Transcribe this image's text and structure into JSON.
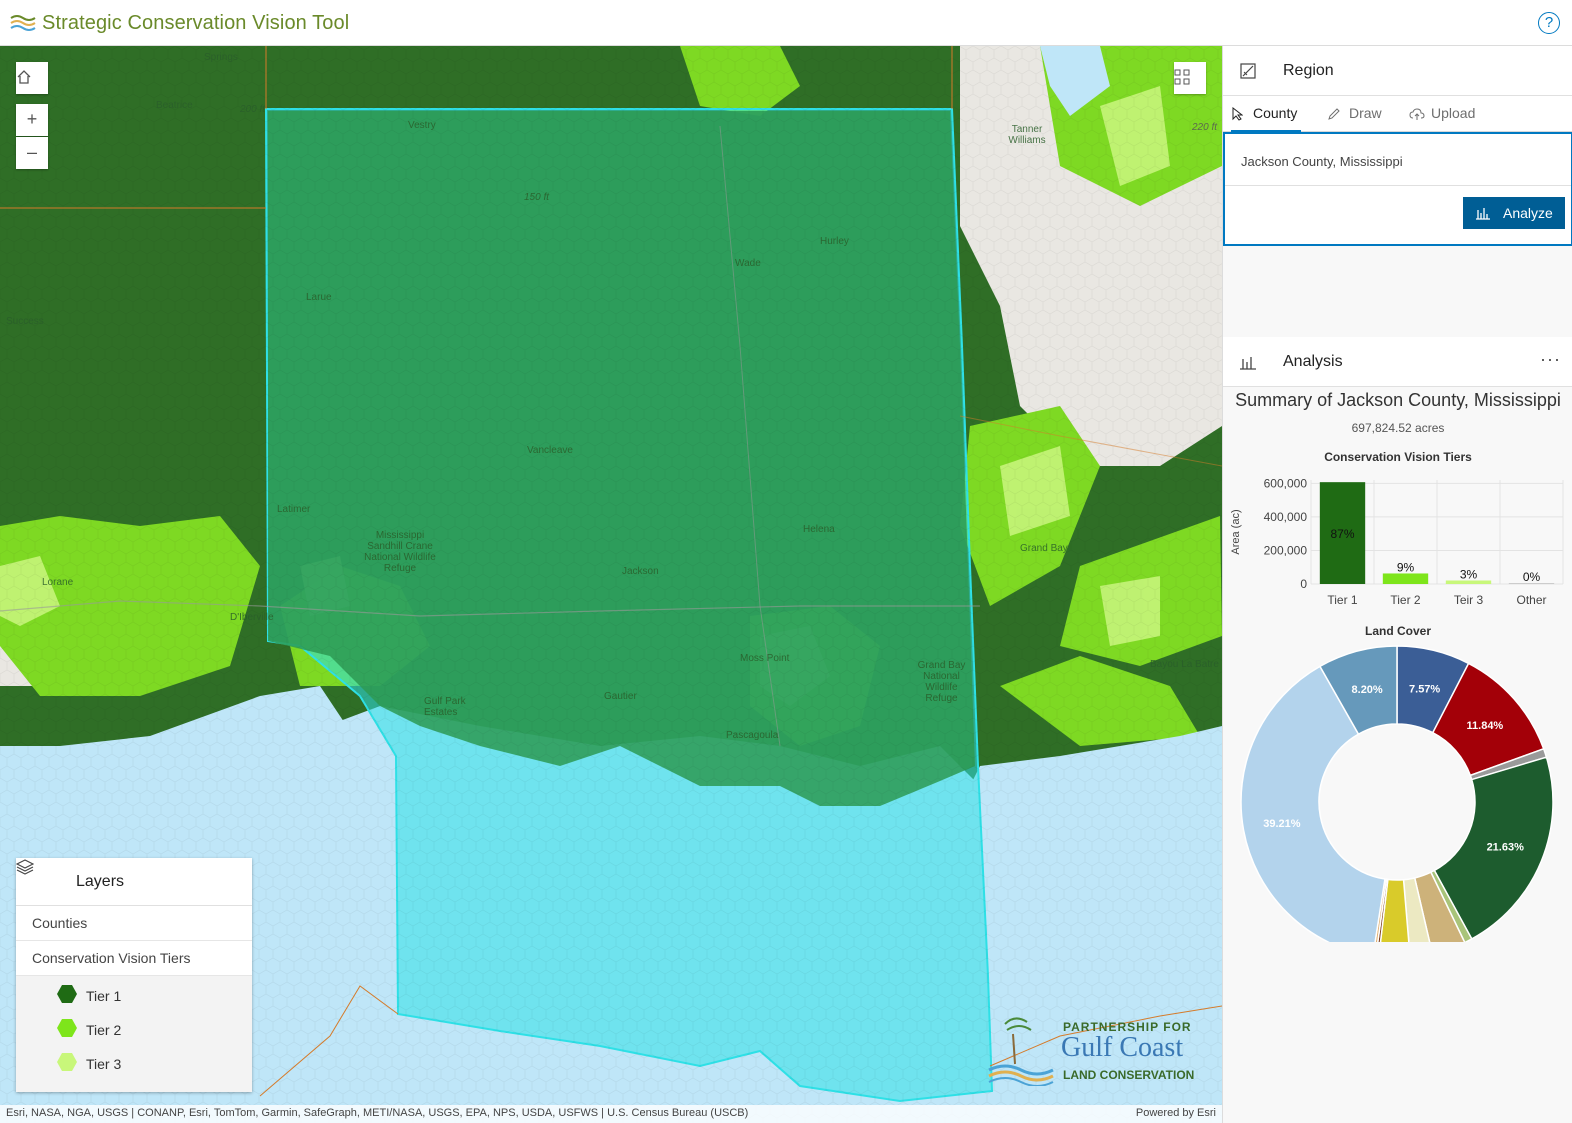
{
  "header": {
    "title": "Strategic Conservation Vision Tool",
    "help_label": "?"
  },
  "map": {
    "zoom_in": "+",
    "zoom_out": "–",
    "labels": [
      "Springs",
      "Beatrice",
      "Vestry",
      "Wade",
      "Larue",
      "Hurley",
      "Vancleave",
      "Latimer",
      "Mississippi Sandhill Crane National Wildlife Refuge",
      "Jackson",
      "Helena",
      "Moss Point",
      "Gautier",
      "Gulf Park Estates",
      "Pascagoula",
      "Grand Bay National Wildlife Refuge",
      "Grand Bay",
      "Bayou La Batre",
      "Tanner Williams",
      "Lorane",
      "D'Iberville",
      "Success",
      "220 ft",
      "150 ft",
      "200 ft"
    ],
    "attribution": "Esri, NASA, NGA, USGS | CONANP, Esri, TomTom, Garmin, SafeGraph, METI/NASA, USGS, EPA, NPS, USDA, USFWS | U.S. Census Bureau (USCB)",
    "powered_by": "Powered by Esri",
    "logo": {
      "line1": "PARTNERSHIP FOR",
      "line2": "Gulf Coast",
      "line3": "LAND CONSERVATION"
    },
    "colors": {
      "tier1": "#2e6f27",
      "tier2": "#84e01d",
      "tier3": "#c3f46a",
      "selection": "#2ee0e6",
      "water": "#bfe6f8"
    }
  },
  "layers": {
    "title": "Layers",
    "items": [
      "Counties",
      "Conservation Vision Tiers"
    ],
    "legend": [
      {
        "label": "Tier 1",
        "color": "#1f6b14"
      },
      {
        "label": "Tier 2",
        "color": "#7ee51b"
      },
      {
        "label": "Tier 3",
        "color": "#c8f77a"
      }
    ]
  },
  "region": {
    "title": "Region",
    "tabs": [
      "County",
      "Draw",
      "Upload"
    ],
    "active_tab": "County",
    "county_value": "Jackson County, Mississippi",
    "analyze_label": "Analyze"
  },
  "analysis": {
    "title": "Analysis",
    "more_label": "···",
    "summary_title": "Summary of Jackson County, Mississippi",
    "acres": "697,824.52 acres"
  },
  "chart_data": [
    {
      "type": "bar",
      "title": "Conservation Vision Tiers",
      "ylabel": "Area (ac)",
      "categories": [
        "Tier 1",
        "Tier 2",
        "Teir 3",
        "Other"
      ],
      "values": [
        607100,
        62800,
        20900,
        500
      ],
      "data_labels": [
        "87%",
        "9%",
        "3%",
        "0%"
      ],
      "colors": [
        "#1f6b14",
        "#7ee51b",
        "#c8f77a",
        "#cccccc"
      ],
      "yticks": [
        "0",
        "200,000",
        "400,000",
        "600,000"
      ],
      "ylim": [
        0,
        620000
      ]
    },
    {
      "type": "pie",
      "title": "Land Cover",
      "donut": true,
      "values": [
        7.57,
        11.84,
        0.9,
        21.63,
        0.8,
        3.5,
        2.3,
        3.2,
        0.3,
        0.3,
        39.21,
        8.2
      ],
      "labels": [
        "7.57%",
        "11.84%",
        "",
        "21.63%",
        "",
        "",
        "",
        "",
        "",
        "",
        "39.21%",
        "8.20%"
      ],
      "colors": [
        "#3b5e96",
        "#a30008",
        "#9a9a9a",
        "#1d5c2e",
        "#a9c47a",
        "#cdb27a",
        "#ece9c2",
        "#d9cb2a",
        "#7a3a1a",
        "#e0b070",
        "#b3d3ec",
        "#6699bb"
      ]
    }
  ]
}
